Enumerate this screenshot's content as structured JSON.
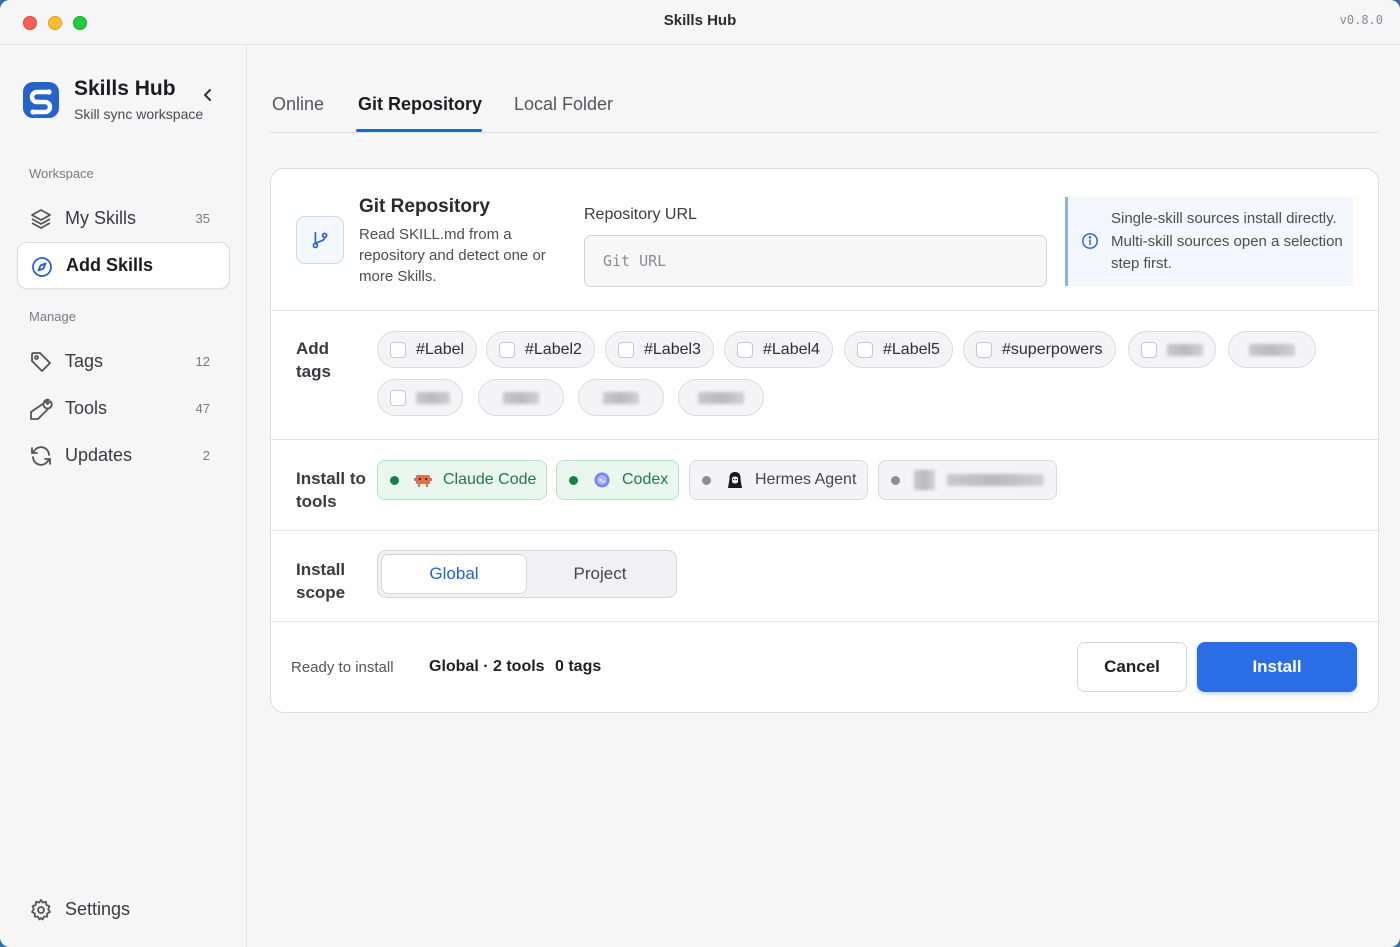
{
  "window": {
    "title": "Skills Hub",
    "version": "v0.8.0"
  },
  "brand": {
    "name": "Skills Hub",
    "subtitle": "Skill sync workspace"
  },
  "sidebar": {
    "workspace_label": "Workspace",
    "manage_label": "Manage",
    "items": [
      {
        "label": "My Skills",
        "count": "35",
        "icon": "layers-icon"
      },
      {
        "label": "Add Skills",
        "count": "",
        "icon": "compass-icon",
        "active": true
      },
      {
        "label": "Tags",
        "count": "12",
        "icon": "tag-icon"
      },
      {
        "label": "Tools",
        "count": "47",
        "icon": "wrench-icon"
      },
      {
        "label": "Updates",
        "count": "2",
        "icon": "refresh-icon"
      }
    ],
    "settings_label": "Settings"
  },
  "tabs": [
    {
      "label": "Online"
    },
    {
      "label": "Git Repository",
      "active": true
    },
    {
      "label": "Local Folder"
    }
  ],
  "source": {
    "title": "Git Repository",
    "description": "Read SKILL.md from a repository and detect one or more Skills.",
    "url_label": "Repository URL",
    "url_placeholder": "Git URL",
    "url_value": "",
    "info": "Single-skill sources install directly. Multi-skill sources open a selection step first."
  },
  "tags": {
    "label": "Add tags",
    "items": [
      "#Label",
      "#Label2",
      "#Label3",
      "#Label4",
      "#Label5",
      "#superpowers"
    ]
  },
  "tools": {
    "label": "Install to tools",
    "items": [
      {
        "name": "Claude Code",
        "enabled": true
      },
      {
        "name": "Codex",
        "enabled": true
      },
      {
        "name": "Hermes Agent",
        "enabled": false
      }
    ]
  },
  "scope": {
    "label": "Install scope",
    "options": [
      "Global",
      "Project"
    ],
    "selected": "Global"
  },
  "footer": {
    "ready": "Ready to install",
    "summary": "Global · 2 tools",
    "tags": "0 tags",
    "cancel": "Cancel",
    "install": "Install"
  },
  "colors": {
    "accent": "#2563c9",
    "primary_button": "#2b6de6",
    "tool_on": "#16824a"
  }
}
